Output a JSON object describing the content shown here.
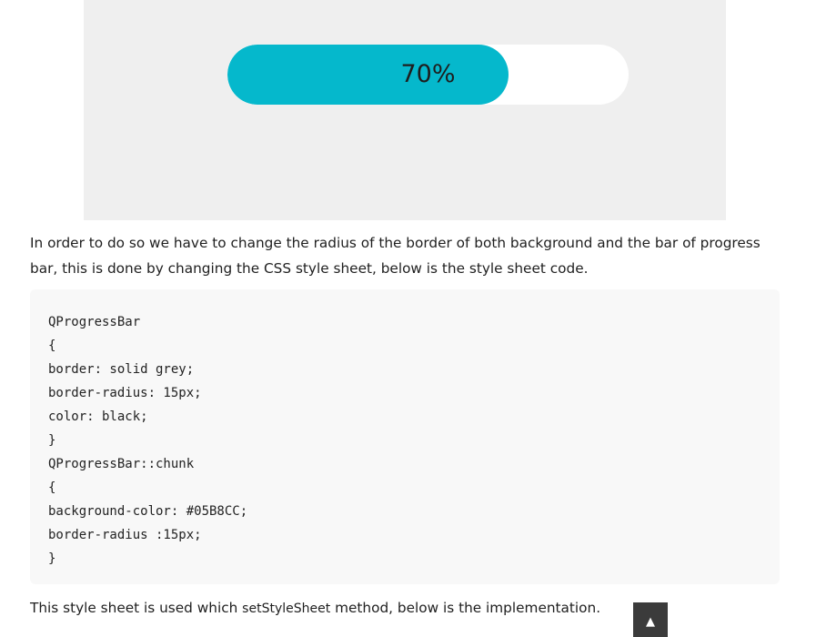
{
  "demo": {
    "progress": {
      "value": 0.7,
      "label": "70%",
      "chunk_color": "#05B8CC",
      "track_color": "#ffffff",
      "background_color": "#efefef"
    }
  },
  "paragraph_1": "In order to do so we have to change the radius of the border of both background and the bar of progress bar, this is done by changing the CSS style sheet, below is the style sheet code.",
  "code": {
    "lines": [
      "QProgressBar",
      "{",
      "border: solid grey;",
      "border-radius: 15px;",
      "color: black;",
      "}",
      "QProgressBar::chunk",
      "{",
      "background-color: #05B8CC;",
      "border-radius :15px;",
      "}"
    ]
  },
  "paragraph_2": {
    "before": "This style sheet is used which ",
    "method": "setStyleSheet",
    "after": " method, below is the implementation."
  },
  "scroll_top": {
    "icon": "up-arrow-icon",
    "glyph": "▲"
  }
}
